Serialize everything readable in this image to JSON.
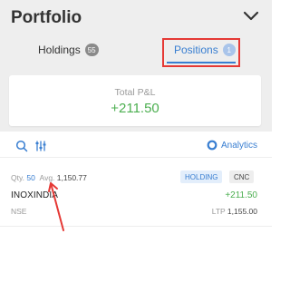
{
  "header": {
    "title": "Portfolio",
    "collapse_icon": "chevron-down-icon"
  },
  "tabs": [
    {
      "label": "Holdings",
      "count": "55",
      "active": false
    },
    {
      "label": "Positions",
      "count": "1",
      "active": true
    }
  ],
  "summary": {
    "label": "Total P&L",
    "value": "+211.50"
  },
  "toolbar": {
    "search_icon": "search-icon",
    "filter_icon": "filter-icon",
    "analytics_label": "Analytics"
  },
  "position": {
    "qty_label": "Qty.",
    "qty_value": "50",
    "avg_label": "Avg.",
    "avg_value": "1,150.77",
    "tags": [
      "HOLDING",
      "CNC"
    ],
    "symbol": "INOXINDIA",
    "exchange": "NSE",
    "pnl": "+211.50",
    "ltp_label": "LTP",
    "ltp_value": "1,155.00"
  },
  "colors": {
    "accent": "#387ed1",
    "profit": "#4caf50",
    "annotation": "#e53935"
  }
}
